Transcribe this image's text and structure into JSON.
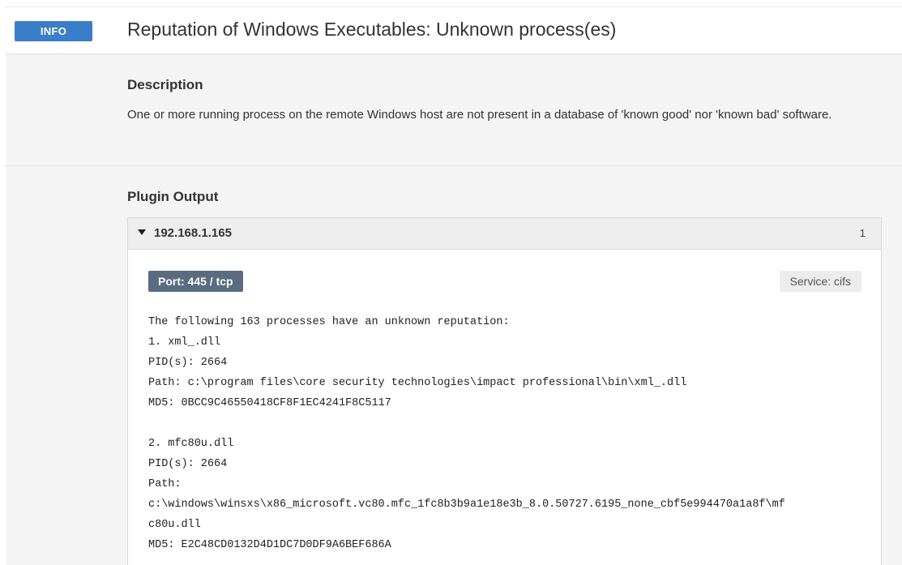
{
  "header": {
    "severity": "INFO",
    "title": "Reputation of Windows Executables: Unknown process(es)"
  },
  "description": {
    "heading": "Description",
    "text": "One or more running process on the remote Windows host are not present in a database of 'known good' nor 'known bad' software."
  },
  "plugin_output": {
    "heading": "Plugin Output",
    "host": {
      "ip": "192.168.1.165",
      "count": "1",
      "port": "Port: 445 / tcp",
      "service": "Service: cifs",
      "lines": [
        "The following 163 processes have an unknown reputation:",
        "1. xml_.dll",
        "PID(s): 2664",
        "Path: c:\\program files\\core security technologies\\impact professional\\bin\\xml_.dll",
        "MD5: 0BCC9C46550418CF8F1EC4241F8C5117",
        "",
        "2. mfc80u.dll",
        "PID(s): 2664",
        "Path:",
        "c:\\windows\\winsxs\\x86_microsoft.vc80.mfc_1fc8b3b9a1e18e3b_8.0.50727.6195_none_cbf5e994470a1a8f\\mf",
        "c80u.dll",
        "MD5: E2C48CD0132D4D1DC7D0DF9A6BEF686A"
      ]
    }
  },
  "colors": {
    "info_badge": "#3a7dc9",
    "port_badge": "#5b6c80",
    "section_bg": "#f4f4f4"
  }
}
